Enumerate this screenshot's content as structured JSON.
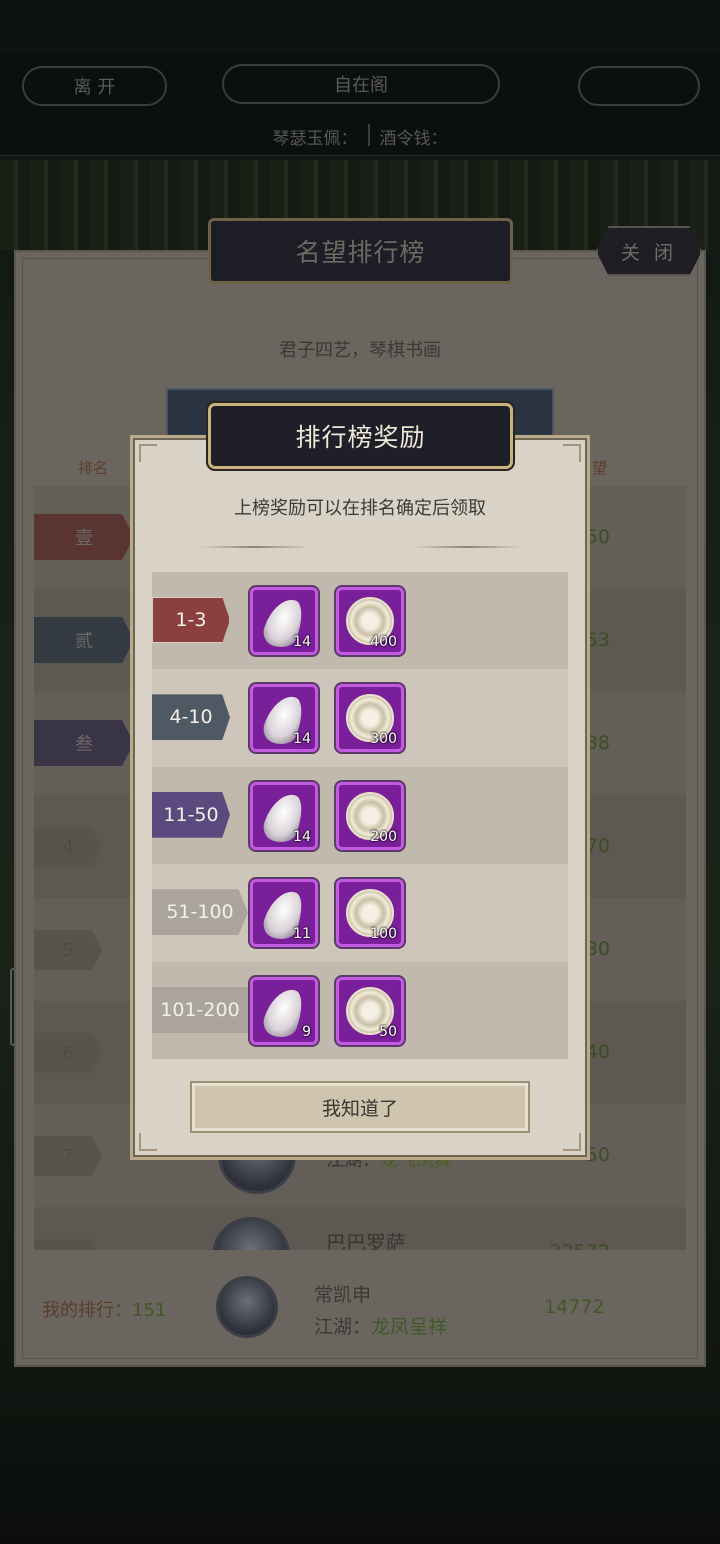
{
  "topbar": {
    "leave_label": "离 开",
    "location": "自在阁",
    "right_label": "",
    "currency_a_label": "琴瑟玉佩：",
    "currency_b_label": "酒令钱："
  },
  "ranking_panel": {
    "title": "名望排行榜",
    "close_label": "关 闭",
    "subtitle": "君子四艺，琴棋书画",
    "col_rank": "排名",
    "col_score": "望",
    "rows": [
      {
        "rank": "壹",
        "score": "50"
      },
      {
        "rank": "贰",
        "score": "53"
      },
      {
        "rank": "叁",
        "score": "38"
      },
      {
        "rank": "4",
        "score": "70"
      },
      {
        "rank": "5",
        "score": "30"
      },
      {
        "rank": "6",
        "score": "40"
      },
      {
        "rank": "7",
        "score": "50",
        "title_prefix": "江湖：",
        "title": "龙飞凤舞"
      },
      {
        "rank": "8",
        "name": "巴巴罗萨",
        "score": "22572"
      }
    ],
    "mine": {
      "label": "我的排行：",
      "rank": "151",
      "name": "常凯申",
      "title_prefix": "江湖：",
      "title": "龙凤呈祥",
      "score": "14772"
    }
  },
  "reward_modal": {
    "title": "排行榜奖励",
    "description": "上榜奖励可以在排名确定后领取",
    "tiers": [
      {
        "range": "1-3",
        "feather_qty": "14",
        "coin_qty": "400"
      },
      {
        "range": "4-10",
        "feather_qty": "14",
        "coin_qty": "300"
      },
      {
        "range": "11-50",
        "feather_qty": "14",
        "coin_qty": "200"
      },
      {
        "range": "51-100",
        "feather_qty": "11",
        "coin_qty": "100"
      },
      {
        "range": "101-200",
        "feather_qty": "9",
        "coin_qty": "50"
      }
    ],
    "confirm_label": "我知道了"
  },
  "icons": {
    "item_a": "feather-icon",
    "item_b": "coin-token-icon"
  },
  "colors": {
    "item_frame": "#c35be0",
    "item_bg": "#7a1f9a",
    "tier_1": "#8b4040",
    "tier_2": "#4e5964",
    "tier_3": "#5b4a7e",
    "tier_other": "#aaa49c",
    "score_green": "#3f5a25"
  }
}
